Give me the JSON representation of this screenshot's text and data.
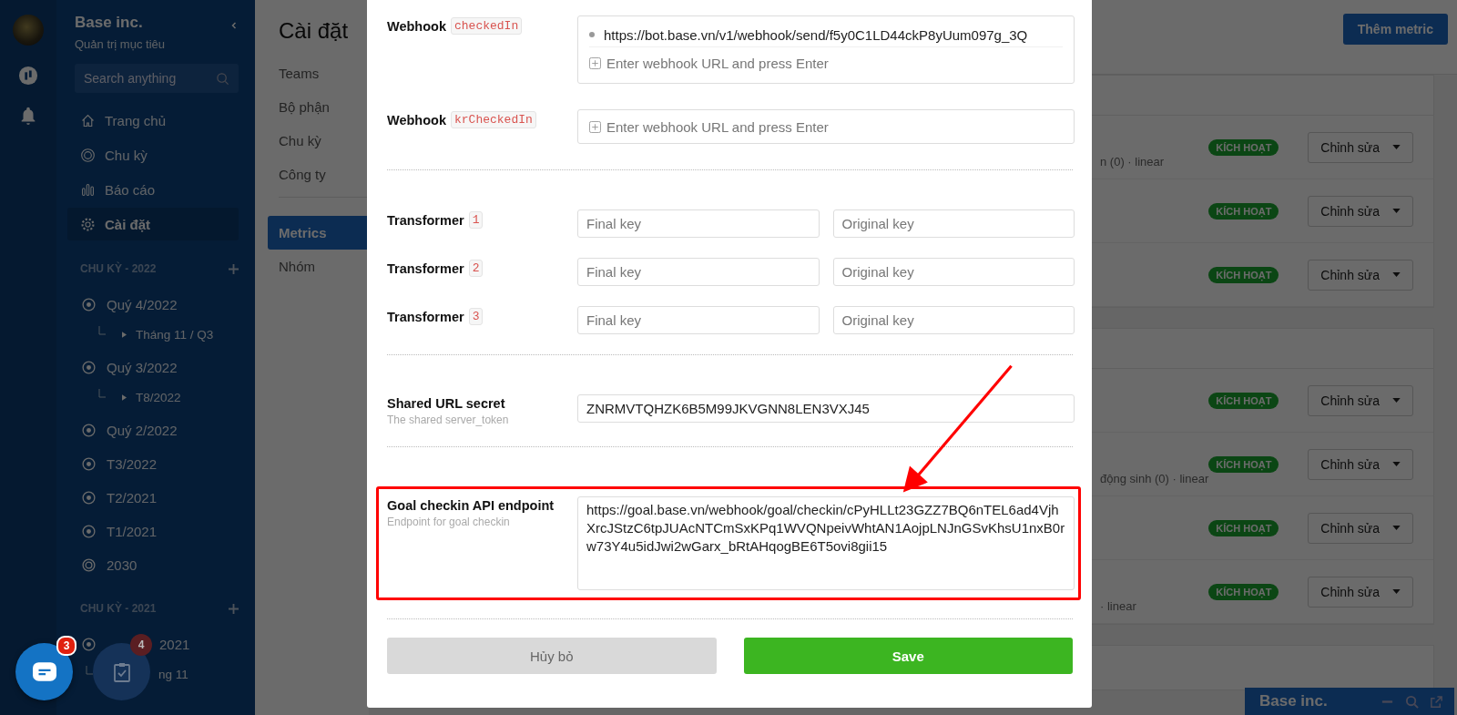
{
  "sidebar": {
    "org_name": "Base inc.",
    "org_subtitle": "Quản trị mục tiêu",
    "search": {
      "placeholder": "Search anything"
    },
    "nav": [
      {
        "label": "Trang chủ",
        "selected": false
      },
      {
        "label": "Chu kỳ",
        "selected": false
      },
      {
        "label": "Báo cáo",
        "selected": false
      },
      {
        "label": "Cài đặt",
        "selected": true
      }
    ],
    "sections": [
      {
        "title": "CHU KỲ - 2022",
        "items": [
          {
            "label": "Quý 4/2022",
            "kind": "period",
            "children": [
              {
                "label": "Tháng 11 / Q3"
              }
            ]
          },
          {
            "label": "Quý 3/2022",
            "kind": "period",
            "children": [
              {
                "label": "T8/2022"
              }
            ]
          },
          {
            "label": "Quý 2/2022",
            "kind": "period"
          },
          {
            "label": "T3/2022",
            "kind": "period"
          },
          {
            "label": "T2/2021",
            "kind": "period"
          },
          {
            "label": "T1/2021",
            "kind": "period"
          },
          {
            "label": "2030",
            "kind": "year"
          }
        ]
      },
      {
        "title": "CHU KỲ - 2021",
        "items": [
          {
            "label": "2021",
            "kind": "period",
            "children": [
              {
                "label": "ng 11"
              }
            ]
          }
        ]
      }
    ]
  },
  "page": {
    "title": "Cài đặt",
    "subnav_groups": [
      {
        "items": [
          {
            "label": "Teams",
            "selected": false
          },
          {
            "label": "Bộ phận",
            "selected": false
          },
          {
            "label": "Chu kỳ",
            "selected": false
          },
          {
            "label": "Công ty",
            "selected": false
          }
        ]
      },
      {
        "items": [
          {
            "label": "Metrics",
            "selected": true
          },
          {
            "label": "Nhóm",
            "selected": false
          }
        ]
      }
    ],
    "add_button": "Thêm metric",
    "groups": [
      {
        "rows": [
          {
            "meta": "n (0) · linear",
            "status": "KÍCH HOẠT",
            "action": "Chỉnh sửa"
          },
          {
            "status": "KÍCH HOẠT",
            "action": "Chỉnh sửa"
          },
          {
            "status": "KÍCH HOẠT",
            "action": "Chỉnh sửa"
          }
        ]
      },
      {
        "rows": [
          {
            "status": "KÍCH HOẠT",
            "action": "Chỉnh sửa"
          },
          {
            "meta": "động sinh (0) · linear",
            "status": "KÍCH HOẠT",
            "action": "Chỉnh sửa"
          },
          {
            "status": "KÍCH HOẠT",
            "action": "Chỉnh sửa"
          },
          {
            "meta": "· linear",
            "status": "KÍCH HOẠT",
            "action": "Chỉnh sửa"
          }
        ]
      }
    ]
  },
  "modal": {
    "sections": [
      {
        "fields": [
          {
            "kind": "webhook",
            "label": "Webhook",
            "code": "checkedIn",
            "tags": [
              "https://bot.base.vn/v1/webhook/send/f5y0C1LD44ckP8yUum097g_3Q"
            ],
            "placeholder": "Enter webhook URL and press Enter"
          },
          {
            "kind": "webhook",
            "label": "Webhook",
            "code": "krCheckedIn",
            "placeholder": "Enter webhook URL and press Enter"
          }
        ]
      },
      {
        "fields": [
          {
            "kind": "pair",
            "label": "Transformer",
            "code": "1",
            "placeholders": [
              "Final key",
              "Original key"
            ]
          },
          {
            "kind": "pair",
            "label": "Transformer",
            "code": "2",
            "placeholders": [
              "Final key",
              "Original key"
            ]
          },
          {
            "kind": "pair",
            "label": "Transformer",
            "code": "3",
            "placeholders": [
              "Final key",
              "Original key"
            ]
          }
        ]
      },
      {
        "fields": [
          {
            "kind": "text",
            "label": "Shared URL secret",
            "hint": "The shared server_token",
            "value": "ZNRMVTQHZK6B5M99JKVGNN8LEN3VXJ45"
          }
        ]
      },
      {
        "fields": [
          {
            "kind": "textarea",
            "label": "Goal checkin API endpoint",
            "hint": "Endpoint for goal checkin",
            "value": "https://goal.base.vn/webhook/goal/checkin/cPyHLLt23GZZ7BQ6nTEL6ad4VjhXrcJStzC6tpJUAcNTCmSxKPq1WVQNpeivWhtAN1AojpLNJnGSvKhsU1nxB0rw73Y4u5idJwi2wGarx_bRtAHqogBE6T5ovi8gii15",
            "highlighted": true
          }
        ]
      }
    ],
    "buttons": [
      {
        "label": "Hủy bỏ",
        "kind": "secondary"
      },
      {
        "label": "Save",
        "kind": "primary"
      }
    ]
  },
  "floating": [
    {
      "kind": "chat",
      "badge": "3"
    },
    {
      "kind": "tasks",
      "badge": "4"
    }
  ],
  "chat_bar": {
    "title": "Base inc."
  }
}
